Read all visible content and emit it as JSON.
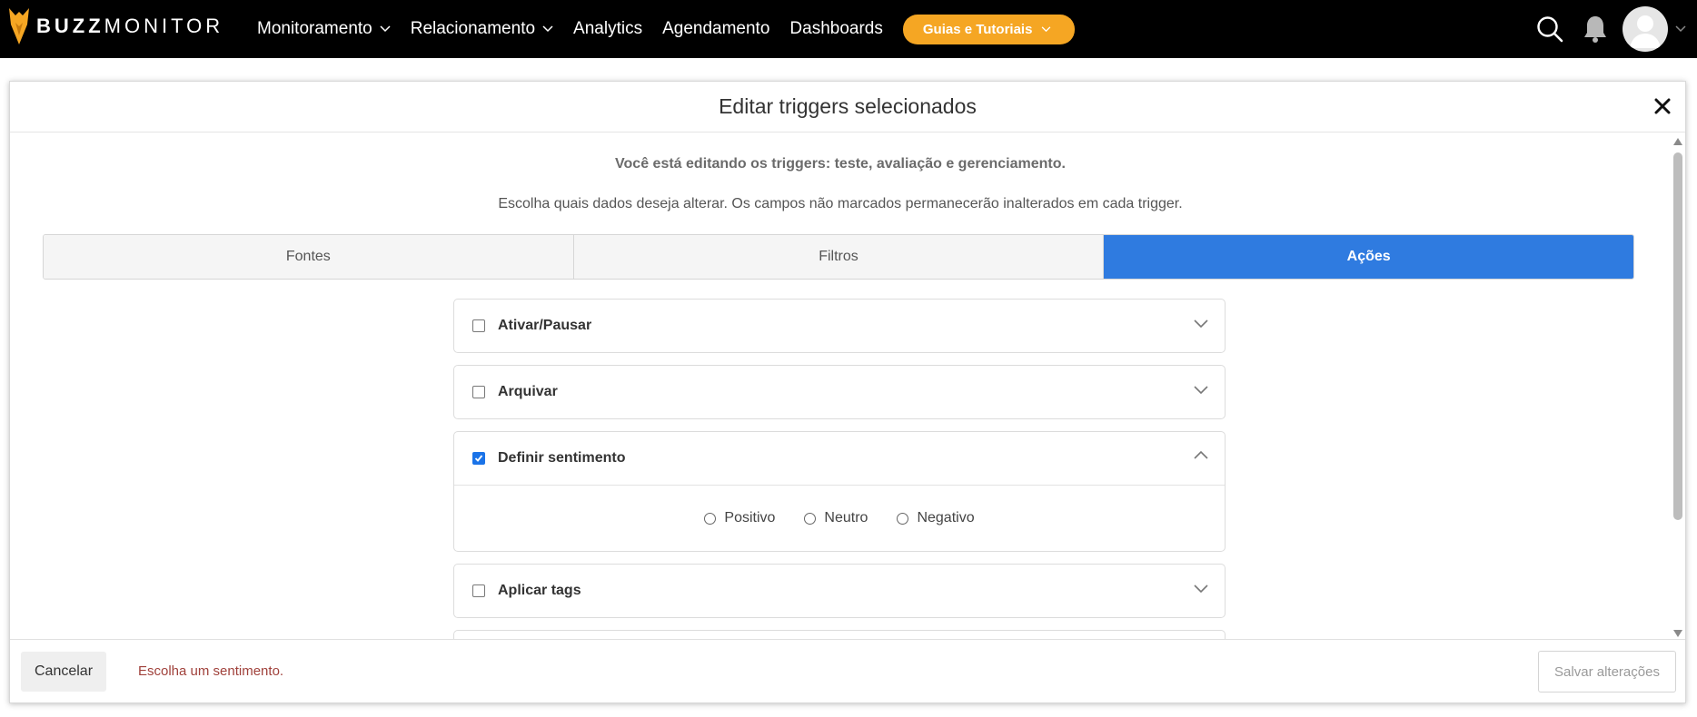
{
  "brand": {
    "bold": "BUZZ",
    "light": "MONITOR",
    "color": "#f5a623"
  },
  "nav": {
    "items": [
      {
        "label": "Monitoramento",
        "has_dropdown": true
      },
      {
        "label": "Relacionamento",
        "has_dropdown": true
      },
      {
        "label": "Analytics",
        "has_dropdown": false
      },
      {
        "label": "Agendamento",
        "has_dropdown": false
      },
      {
        "label": "Dashboards",
        "has_dropdown": false
      }
    ],
    "guides_label": "Guias e Tutoriais"
  },
  "header_icons": [
    "search-icon",
    "bell-icon",
    "avatar-icon"
  ],
  "modal": {
    "title": "Editar triggers selecionados",
    "intro_line1": "Você está editando os triggers: teste, avaliação e gerenciamento.",
    "intro_line2": "Escolha quais dados deseja alterar. Os campos não marcados permanecerão inalterados em cada trigger.",
    "tabs": [
      {
        "label": "Fontes",
        "active": false
      },
      {
        "label": "Filtros",
        "active": false
      },
      {
        "label": "Ações",
        "active": true
      }
    ],
    "sections": [
      {
        "label": "Ativar/Pausar",
        "checked": false,
        "expanded": false
      },
      {
        "label": "Arquivar",
        "checked": false,
        "expanded": false
      },
      {
        "label": "Definir sentimento",
        "checked": true,
        "expanded": true,
        "options": [
          "Positivo",
          "Neutro",
          "Negativo"
        ]
      },
      {
        "label": "Aplicar tags",
        "checked": false,
        "expanded": false
      }
    ],
    "footer": {
      "cancel_label": "Cancelar",
      "message": "Escolha um sentimento.",
      "save_label": "Salvar alterações"
    }
  },
  "colors": {
    "accent": "#2f7be0",
    "guides": "#f5a623",
    "error": "#a0413b",
    "topbar": "#000000"
  }
}
